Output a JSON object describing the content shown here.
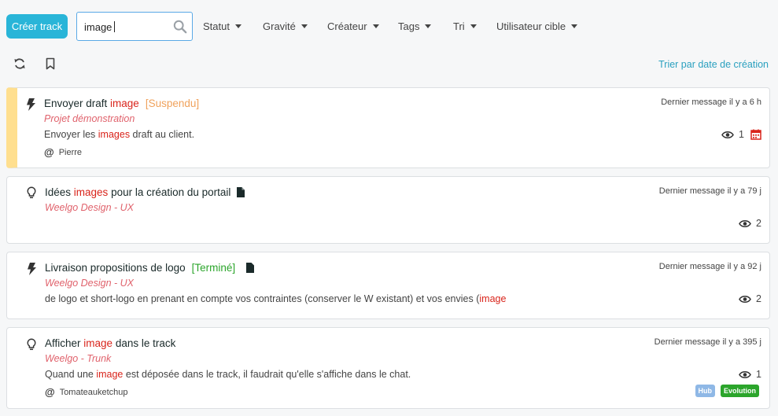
{
  "toolbar": {
    "create_label": "Créer track",
    "search_value": "image",
    "filters": [
      "Statut",
      "Gravité",
      "Créateur",
      "Tags",
      "Tri",
      "Utilisateur cible"
    ],
    "sort_link": "Trier par date de création"
  },
  "tracks": [
    {
      "type_icon": "bolt-icon",
      "title_parts": [
        "Envoyer draft ",
        "image"
      ],
      "status": "[Suspendu]",
      "project": "Projet démonstration",
      "desc_parts": [
        "Envoyer les ",
        "images",
        " draft au client."
      ],
      "author": "Pierre",
      "last_message": "Dernier message il y a 6 h",
      "views": "1"
    },
    {
      "type_icon": "lightbulb-icon",
      "title_parts": [
        "Idées ",
        "images",
        " pour la création du portail"
      ],
      "project": "Weelgo Design - UX",
      "last_message": "Dernier message il y a 79 j",
      "views": "2"
    },
    {
      "type_icon": "bolt-icon",
      "title_parts": [
        "Livraison propositions de logo"
      ],
      "status": "[Terminé]",
      "project": "Weelgo Design - UX",
      "desc_parts": [
        "de logo et short-logo en prenant en compte vos contraintes (conserver le W existant) et vos envies (",
        "image"
      ],
      "last_message": "Dernier message il y a 92 j",
      "views": "2"
    },
    {
      "type_icon": "lightbulb-icon",
      "title_parts": [
        "Afficher ",
        "image",
        " dans le track"
      ],
      "project": "Weelgo - Trunk",
      "desc_parts": [
        "Quand une ",
        "image",
        " est déposée dans le track, il faudrait qu'elle s'affiche dans le chat."
      ],
      "author": "Tomateauketchup",
      "last_message": "Dernier message il y a 395 j",
      "views": "1",
      "tags": [
        "Hub",
        "Evolution"
      ]
    }
  ],
  "colors": {
    "accent": "#29b5d8",
    "highlight": "#d9241b",
    "project": "#e0626c",
    "suspended_bar": "#ffdf8f",
    "tag_hub": "#8fb8e6",
    "tag_evolution": "#2ba52b"
  }
}
